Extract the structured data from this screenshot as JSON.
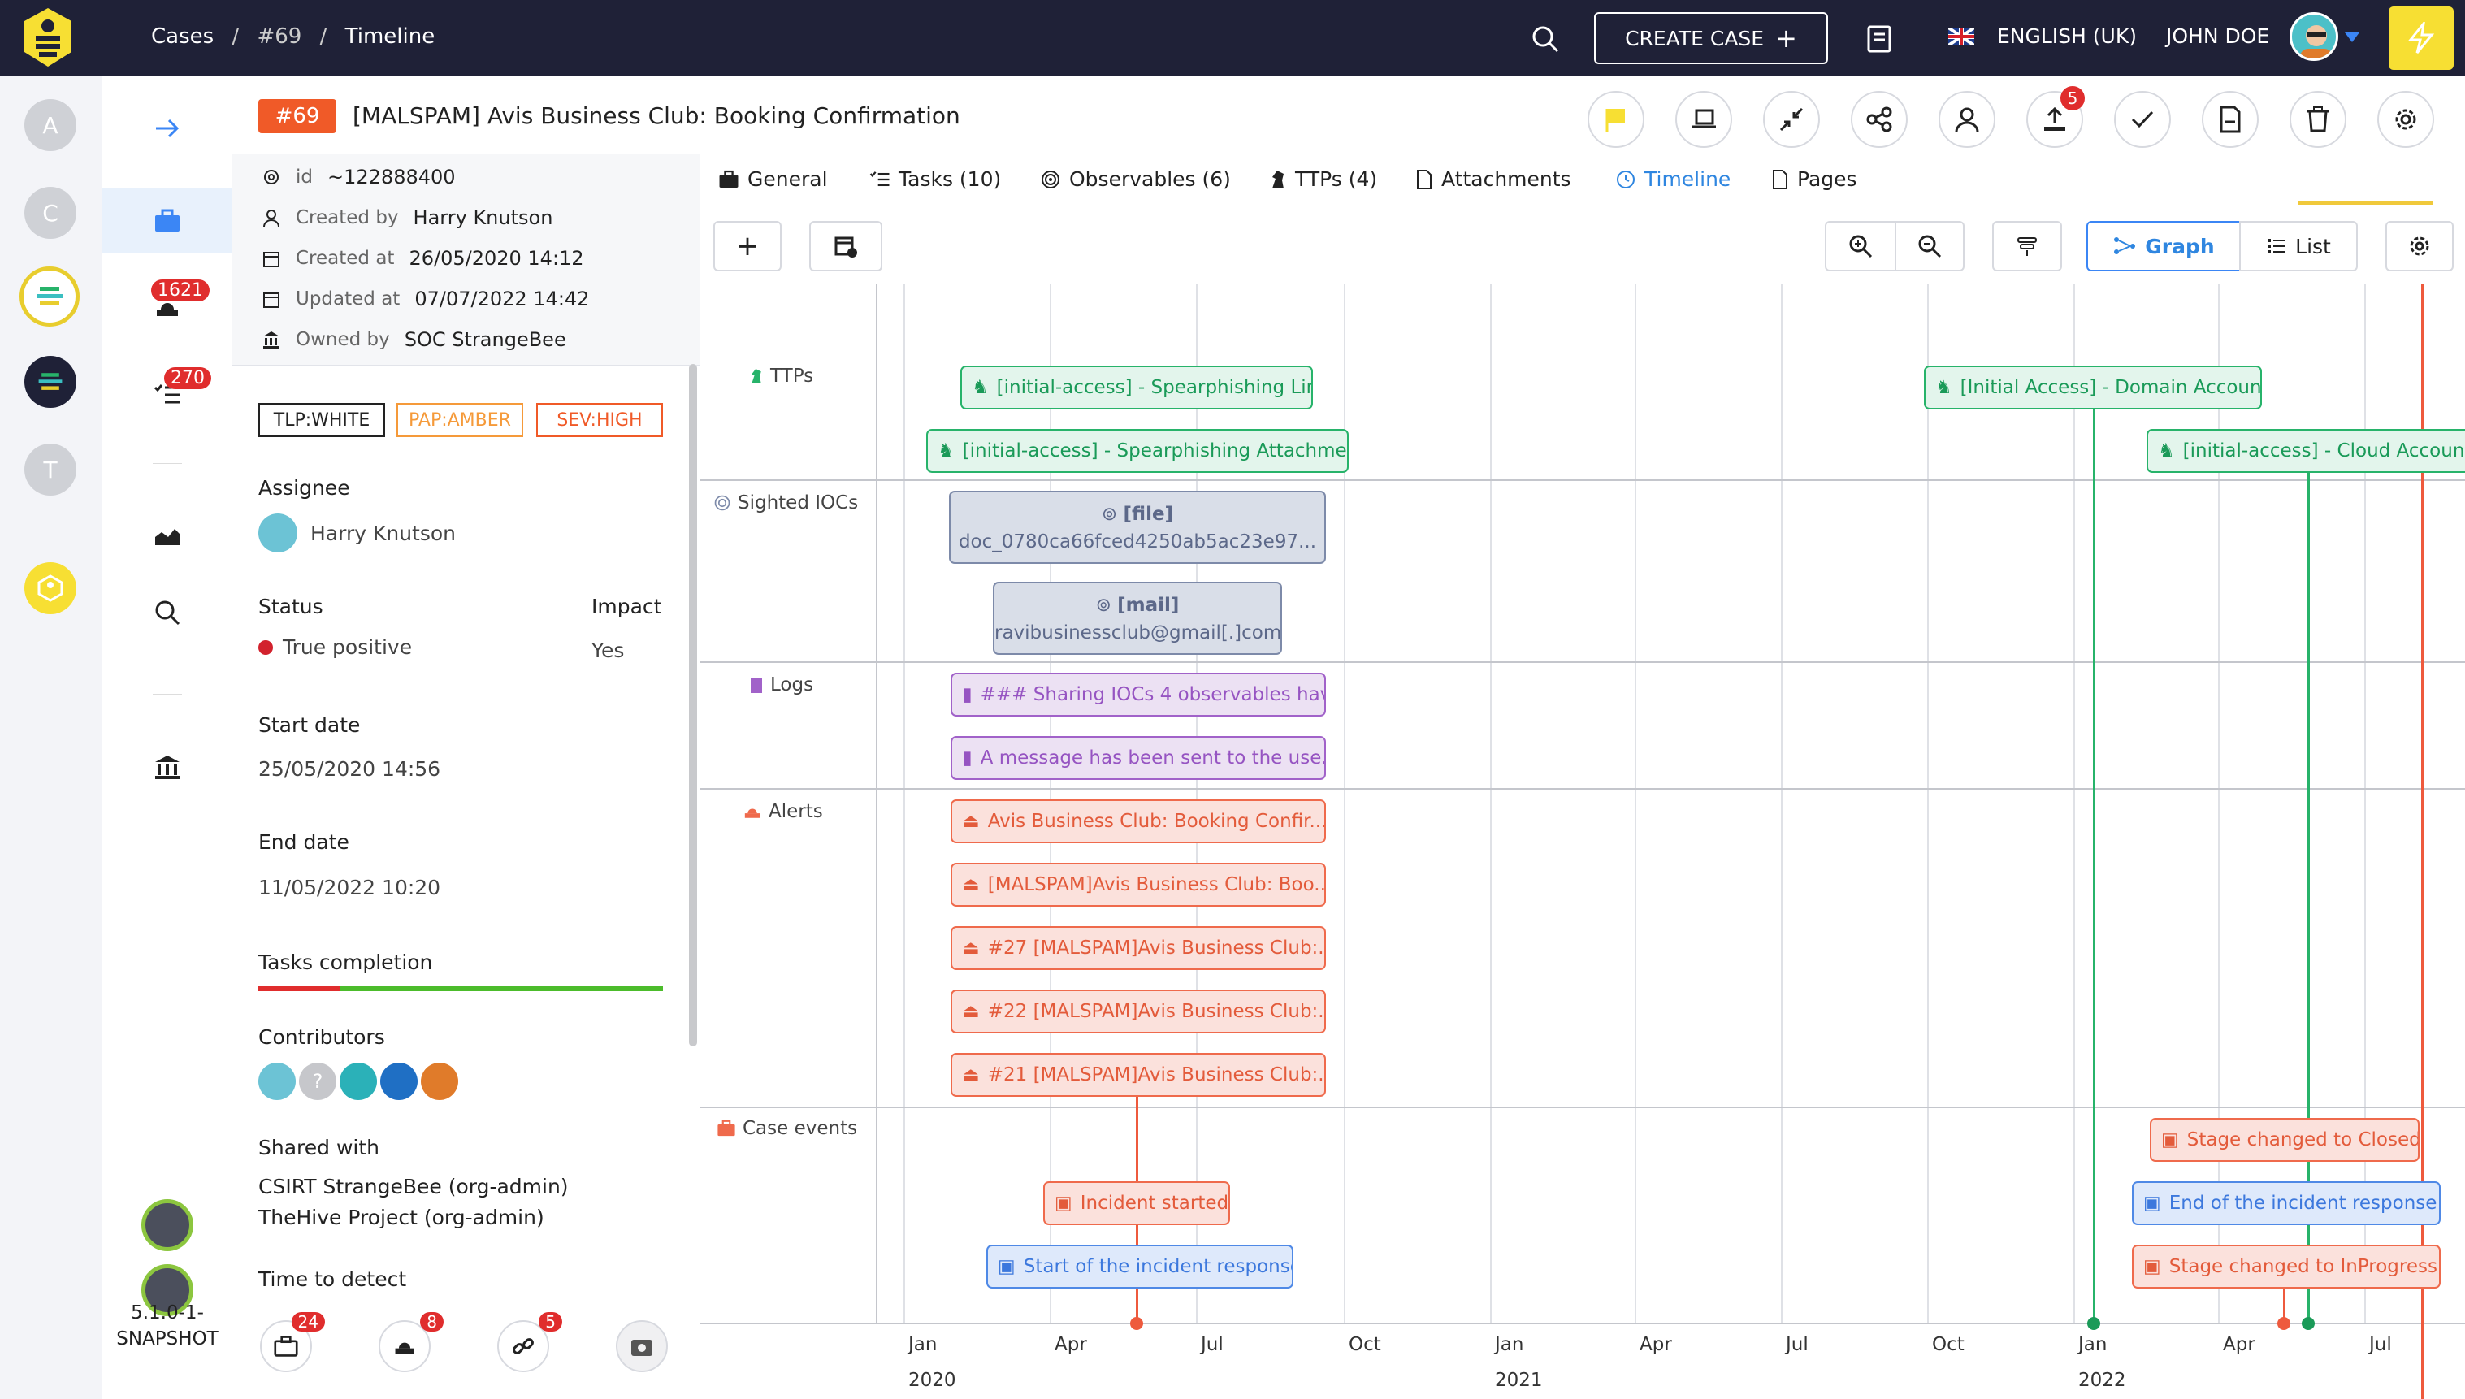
{
  "topbar": {
    "breadcrumbs": [
      "Cases",
      "#69",
      "Timeline"
    ],
    "create_case": "CREATE CASE",
    "language": "ENGLISH (UK)",
    "user": "JOHN DOE"
  },
  "rail": {
    "orgs": [
      "A",
      "C",
      "T"
    ],
    "alerts_badge": "1621",
    "tasks_badge": "270",
    "version_line1": "5.1.0-1-",
    "version_line2": "SNAPSHOT"
  },
  "case": {
    "number": "#69",
    "title": "[MALSPAM] Avis Business Club: Booking Confirmation",
    "upload_badge": "5"
  },
  "meta": {
    "id_label": "id",
    "id_value": "~122888400",
    "created_by_label": "Created by",
    "created_by_value": "Harry Knutson",
    "created_at_label": "Created at",
    "created_at_value": "26/05/2020 14:12",
    "updated_at_label": "Updated at",
    "updated_at_value": "07/07/2022 14:42",
    "owned_by_label": "Owned by",
    "owned_by_value": "SOC StrangeBee"
  },
  "tags": {
    "tlp": "TLP:WHITE",
    "pap": "PAP:AMBER",
    "sev": "SEV:HIGH"
  },
  "details": {
    "assignee_label": "Assignee",
    "assignee_value": "Harry Knutson",
    "status_label": "Status",
    "status_value": "True positive",
    "impact_label": "Impact",
    "impact_value": "Yes",
    "start_label": "Start date",
    "start_value": "25/05/2020 14:56",
    "end_label": "End date",
    "end_value": "11/05/2022 10:20",
    "tasks_label": "Tasks completion",
    "tasks_done_fraction": 0.2,
    "contributors_label": "Contributors",
    "shared_label": "Shared with",
    "shared_1": "CSIRT StrangeBee (org-admin)",
    "shared_2": "TheHive Project (org-admin)",
    "ttd_label": "Time to detect"
  },
  "bottom_badges": {
    "cases": "24",
    "alerts": "8",
    "observables": "5"
  },
  "tabs": {
    "general": "General",
    "tasks": "Tasks (10)",
    "observables": "Observables (6)",
    "ttps": "TTPs (4)",
    "attachments": "Attachments",
    "timeline": "Timeline",
    "pages": "Pages"
  },
  "toolbar": {
    "graph": "Graph",
    "list": "List"
  },
  "lanes": {
    "ttps": "TTPs",
    "iocs": "Sighted IOCs",
    "logs": "Logs",
    "alerts": "Alerts",
    "case_events": "Case events"
  },
  "events": {
    "ttp1": "[initial-access] - Spearphishing Link",
    "ttp2": "[initial-access] - Spearphishing Attachment",
    "ttp3": "[Initial Access] - Domain Accounts",
    "ttp4": "[initial-access] - Cloud Accounts",
    "ioc1_type": "[file]",
    "ioc1_value": "doc_0780ca66fced4250ab5ac23e97...",
    "ioc2_type": "[mail]",
    "ioc2_value": "ravibusinessclub@gmail[.]com",
    "log1": "### Sharing IOCs 4 observables hav...",
    "log2": "A message has been sent to the use...",
    "alert1": "Avis Business Club: Booking Confir...",
    "alert2": "[MALSPAM]Avis Business Club: Boo...",
    "alert3": "#27 [MALSPAM]Avis Business Club:...",
    "alert4": "#22 [MALSPAM]Avis Business Club:...",
    "alert5": "#21 [MALSPAM]Avis Business Club:...",
    "ev1": "Incident started",
    "ev2": "Start of the incident response",
    "ev3": "Stage changed to Closed",
    "ev4": "End of the incident response",
    "ev5": "Stage changed to InProgress"
  },
  "axis": {
    "m1": "Jan",
    "m2": "Apr",
    "m3": "Jul",
    "m4": "Oct",
    "m5": "Jan",
    "m6": "Apr",
    "m7": "Jul",
    "m8": "Oct",
    "m9": "Jan",
    "m10": "Apr",
    "m11": "Jul",
    "y1": "2020",
    "y2": "2021",
    "y3": "2022"
  },
  "colors": {
    "topbar": "#1f2137",
    "accent": "#f0c93b",
    "case_badge": "#f05a28",
    "ttp": "#27b36a",
    "alert": "#ef6a4c",
    "log": "#a162c9",
    "ioc": "#7d8aa9",
    "response": "#4f89e6"
  }
}
